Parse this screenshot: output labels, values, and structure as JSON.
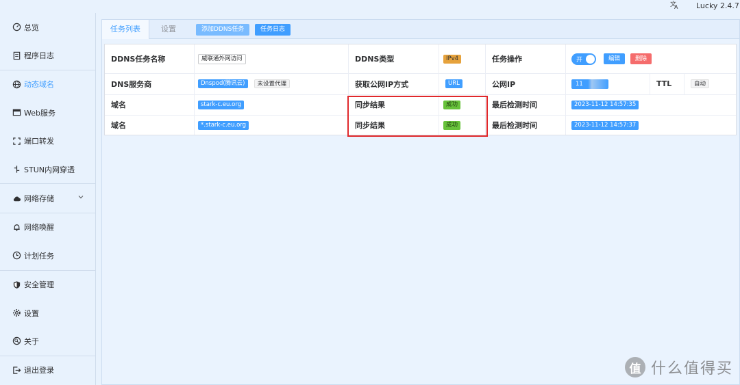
{
  "topbar": {
    "app_version": "Lucky 2.4.7",
    "translate_icon": "translate-icon"
  },
  "sidebar": {
    "items": [
      {
        "label": "总览",
        "icon": "dashboard-icon"
      },
      {
        "label": "程序日志",
        "icon": "log-icon"
      },
      {
        "label": "动态域名",
        "icon": "globe-icon",
        "active": true
      },
      {
        "label": "Web服务",
        "icon": "web-icon"
      },
      {
        "label": "端口转发",
        "icon": "port-forward-icon"
      },
      {
        "label": "STUN内网穿透",
        "icon": "stun-icon"
      },
      {
        "label": "网络存储",
        "icon": "cloud-icon",
        "expandable": true
      },
      {
        "label": "网络唤醒",
        "icon": "bell-icon"
      },
      {
        "label": "计划任务",
        "icon": "clock-icon"
      },
      {
        "label": "安全管理",
        "icon": "shield-icon"
      },
      {
        "label": "设置",
        "icon": "gear-icon"
      },
      {
        "label": "关于",
        "icon": "about-icon"
      },
      {
        "label": "退出登录",
        "icon": "logout-icon"
      }
    ]
  },
  "tabs": {
    "task_list": "任务列表",
    "settings": "设置"
  },
  "toolbar": {
    "add_ddns": "添加DDNS任务",
    "task_log": "任务日志"
  },
  "task": {
    "name_label": "DDNS任务名称",
    "name_value": "威联通外网访问",
    "type_label": "DDNS类型",
    "type_value": "IPv4",
    "ops_label": "任务操作",
    "switch_label": "开",
    "edit_label": "编辑",
    "delete_label": "删除",
    "dns_label": "DNS服务商",
    "dns_value": "Dnspod(腾讯云)",
    "proxy_value": "未设置代理",
    "ip_method_label": "获取公网IP方式",
    "ip_method_value": "URL",
    "public_ip_label": "公网IP",
    "public_ip_value": "11",
    "ttl_label": "TTL",
    "ttl_value": "自动",
    "rows": [
      {
        "domain_label": "域名",
        "domain_value": "stark-c.eu.org",
        "sync_label": "同步结果",
        "sync_value": "成功",
        "check_label": "最后检测时间",
        "check_value": "2023-11-12 14:57:35"
      },
      {
        "domain_label": "域名",
        "domain_value": "*.stark-c.eu.org",
        "sync_label": "同步结果",
        "sync_value": "成功",
        "check_label": "最后检测时间",
        "check_value": "2023-11-12 14:57:37"
      }
    ]
  },
  "watermark": {
    "logo": "值",
    "text": "什么值得买"
  },
  "colors": {
    "primary": "#409eff",
    "success": "#67c23a",
    "warning": "#e6a23c",
    "danger": "#f56c6c",
    "highlight": "#e0282b"
  }
}
